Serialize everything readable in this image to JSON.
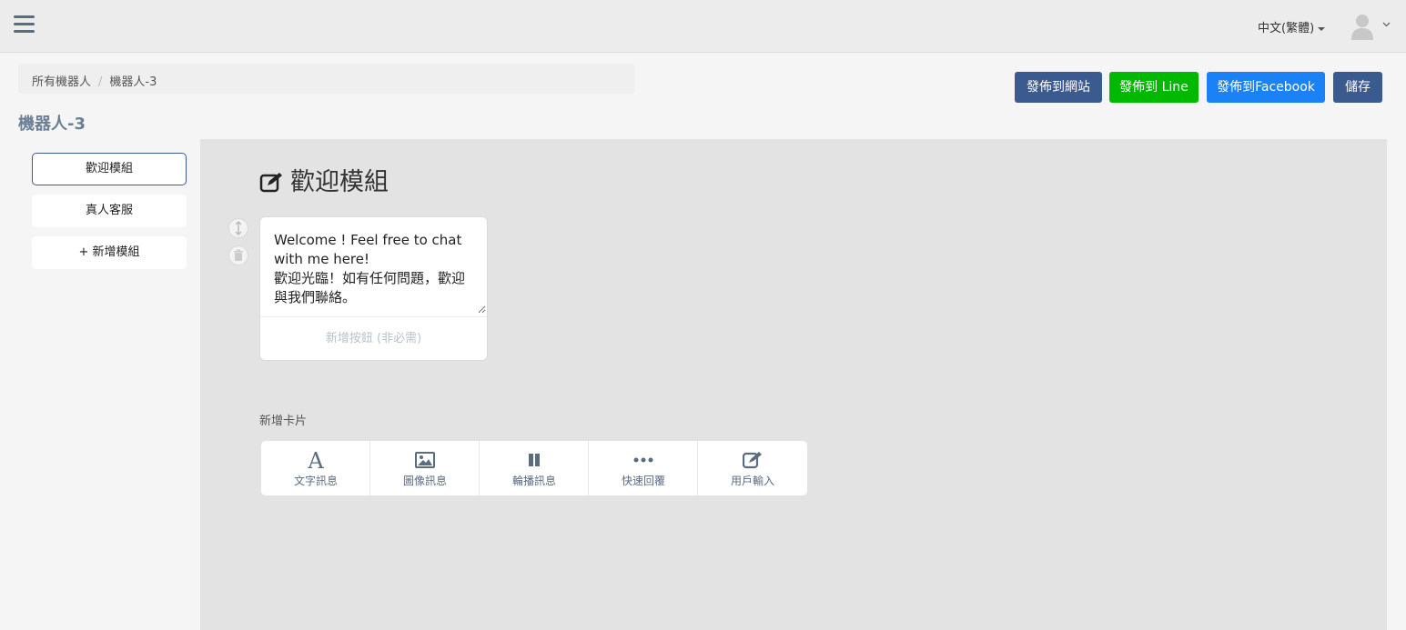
{
  "topbar": {
    "language": "中文(繁體)",
    "icons": [
      "hamburger-menu-icon",
      "user-avatar-icon",
      "chevron-down-icon"
    ]
  },
  "breadcrumb": {
    "items": [
      "所有機器人",
      "機器人-3"
    ]
  },
  "page": {
    "title": "機器人-3"
  },
  "actions": {
    "publish_web": "發佈到網站",
    "publish_line": "發佈到 Line",
    "publish_facebook": "發佈到Facebook",
    "save": "儲存"
  },
  "modules": {
    "items": [
      {
        "label": "歡迎模組",
        "active": true
      },
      {
        "label": "真人客服",
        "active": false
      },
      {
        "label": "+ 新增模組",
        "active": false
      }
    ]
  },
  "editor": {
    "header": "歡迎模組",
    "message_text": "Welcome ! Feel free to chat with me here!\n歡迎光臨！如有任何問題，歡迎與我們聯絡。",
    "add_button_label": "新增按鈕 (非必需)",
    "add_card_label": "新增卡片",
    "card_types": [
      {
        "label": "文字訊息",
        "icon": "text-icon"
      },
      {
        "label": "圖像訊息",
        "icon": "image-icon"
      },
      {
        "label": "輪播訊息",
        "icon": "carousel-icon"
      },
      {
        "label": "快速回覆",
        "icon": "ellipsis-icon"
      },
      {
        "label": "用戶輸入",
        "icon": "edit-icon"
      }
    ]
  },
  "colors": {
    "primary": "#3b5a8f",
    "line_green": "#00b900",
    "facebook_blue": "#1a82f5",
    "title_gray": "#6b7f95"
  }
}
